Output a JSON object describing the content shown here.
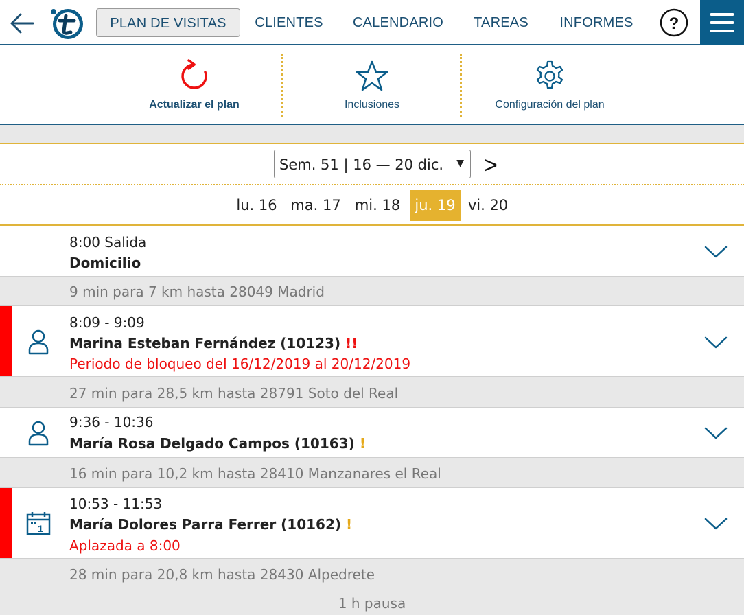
{
  "nav": {
    "items": [
      "PLAN DE VISITAS",
      "CLIENTES",
      "CALENDARIO",
      "TAREAS",
      "INFORMES"
    ],
    "active_index": 0,
    "help_label": "?"
  },
  "actions": {
    "refresh_label": "Actualizar el plan",
    "inclusions_label": "Inclusiones",
    "config_label": "Configuración del plan"
  },
  "week": {
    "selected": "Sem. 51 | 16 — 20 dic.",
    "next_label": ">"
  },
  "days": [
    "lu. 16",
    "ma. 17",
    "mi. 18",
    "ju. 19",
    "vi. 20"
  ],
  "selected_day_index": 3,
  "start": {
    "time": "8:00 Salida",
    "place": "Domicilio"
  },
  "legs": [
    "9 min para 7 km hasta 28049 Madrid",
    "27 min para 28,5 km hasta 28791 Soto del Real",
    "16 min para 10,2 km hasta 28410 Manzanares el Real",
    "28 min para 20,8 km hasta 28430 Alpedrete"
  ],
  "visits": [
    {
      "time": "8:09 - 9:09",
      "client": "Marina Esteban Fernández (10123)",
      "flag": "!!",
      "note": "Periodo de bloqueo del 16/12/2019 al 20/12/2019",
      "icon": "person-icon",
      "alert": true
    },
    {
      "time": "9:36 - 10:36",
      "client": "María Rosa Delgado Campos (10163)",
      "flag": "!",
      "note": "",
      "icon": "person-icon",
      "alert": false
    },
    {
      "time": "10:53 - 11:53",
      "client": "María Dolores Parra Ferrer (10162)",
      "flag": "!",
      "note": "Aplazada a 8:00",
      "icon": "calendar-icon",
      "alert": true
    }
  ],
  "pause": "1 h pausa",
  "colors": {
    "brand_blue": "#0b5d8a",
    "accent_amber": "#e5b22f",
    "alert_red": "#ff0000",
    "text_blue": "#1b4f72"
  }
}
